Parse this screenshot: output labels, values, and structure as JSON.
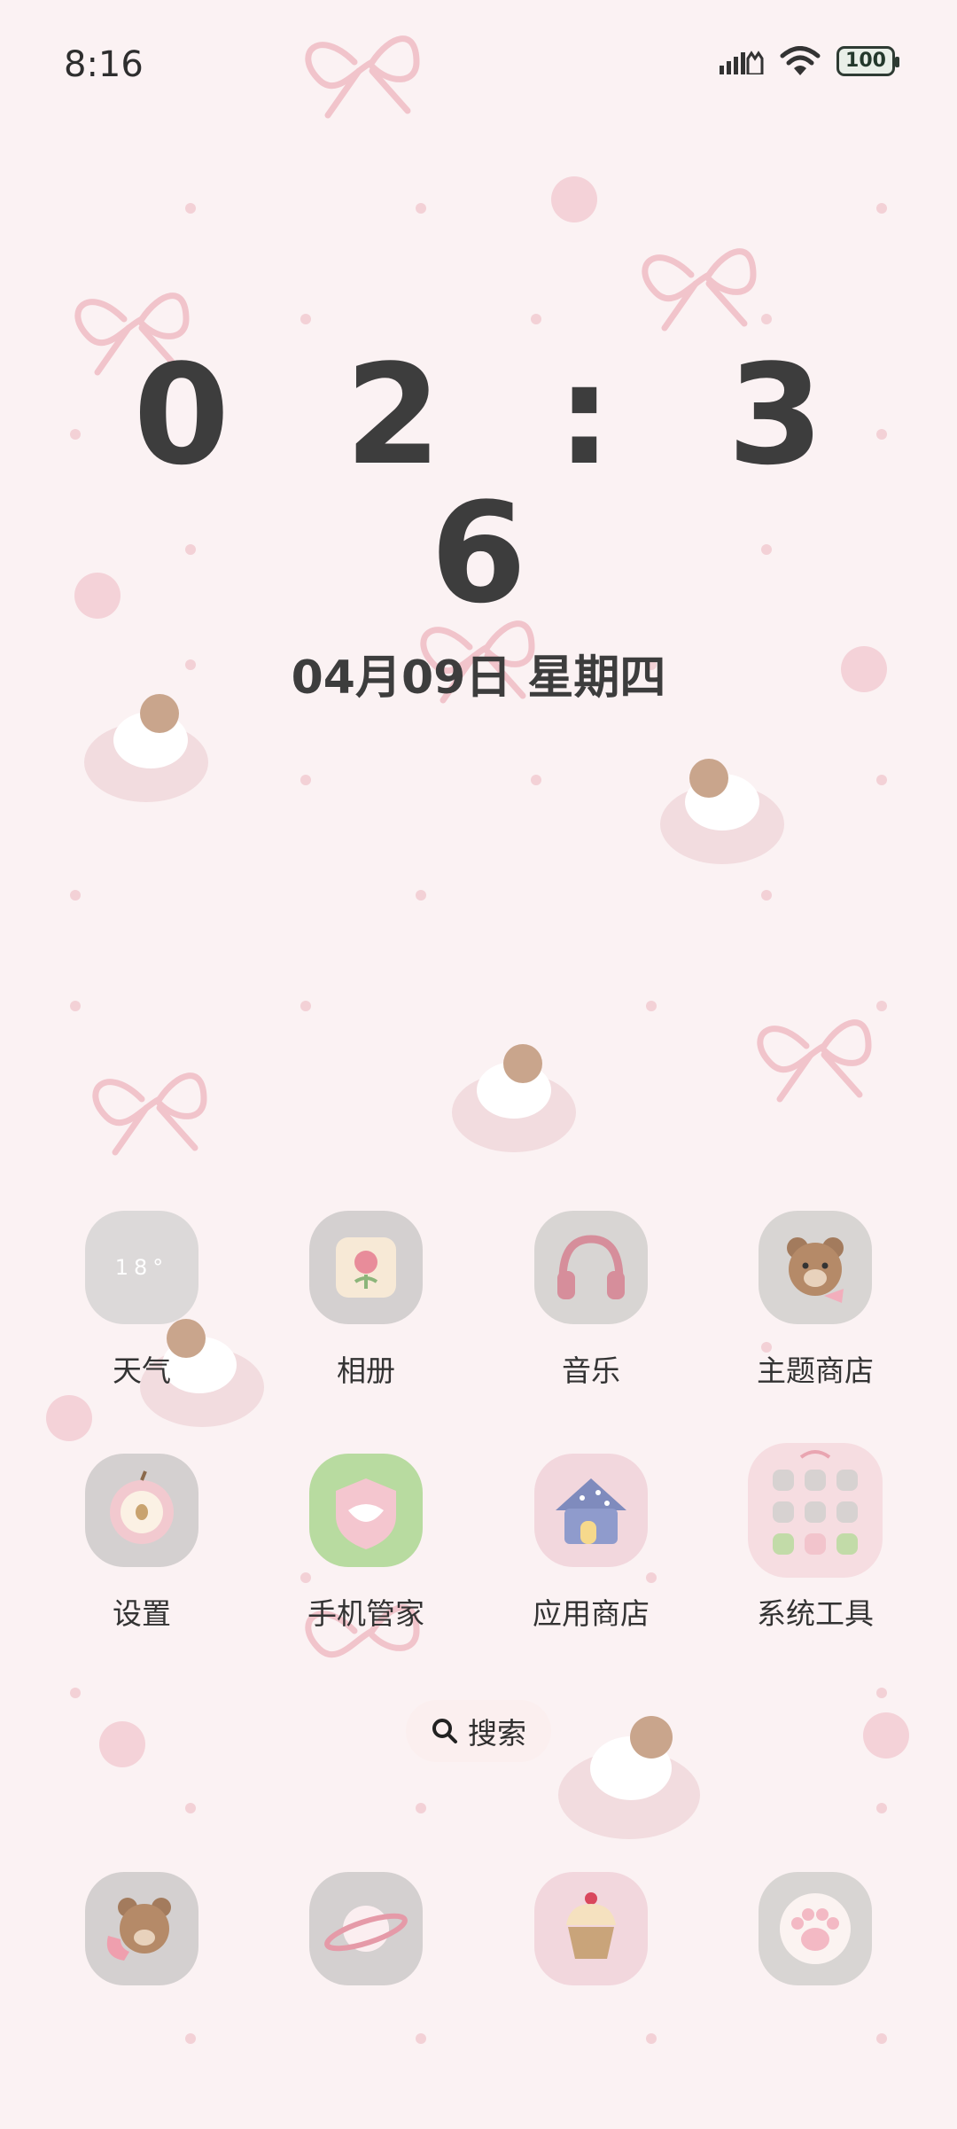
{
  "status_bar": {
    "time": "8:16",
    "battery": "100",
    "icons": [
      "signal-icon",
      "cat-ear-icon",
      "wifi-icon",
      "battery-icon"
    ]
  },
  "clock_widget": {
    "time": "0 2 : 3 6",
    "date": "04月09日 星期四"
  },
  "apps": [
    {
      "label": "天气",
      "icon": "weather-icon",
      "temp": "18°"
    },
    {
      "label": "相册",
      "icon": "gallery-icon"
    },
    {
      "label": "音乐",
      "icon": "headphones-icon"
    },
    {
      "label": "主题商店",
      "icon": "bear-icon"
    },
    {
      "label": "设置",
      "icon": "apple-icon"
    },
    {
      "label": "手机管家",
      "icon": "shield-lips-icon"
    },
    {
      "label": "应用商店",
      "icon": "house-icon"
    },
    {
      "label": "系统工具",
      "icon": "folder-icon"
    }
  ],
  "search": {
    "label": "搜索",
    "icon": "search-icon"
  },
  "dock": [
    {
      "icon": "phone-bear-icon"
    },
    {
      "icon": "planet-icon"
    },
    {
      "icon": "cupcake-icon"
    },
    {
      "icon": "paw-icon"
    }
  ],
  "colors": {
    "background": "#fbf2f3",
    "bow": "#f1c6cc",
    "icon_gray": "#d6d3d3",
    "icon_green": "#b8dba0",
    "icon_pink": "#f2d7dd"
  }
}
